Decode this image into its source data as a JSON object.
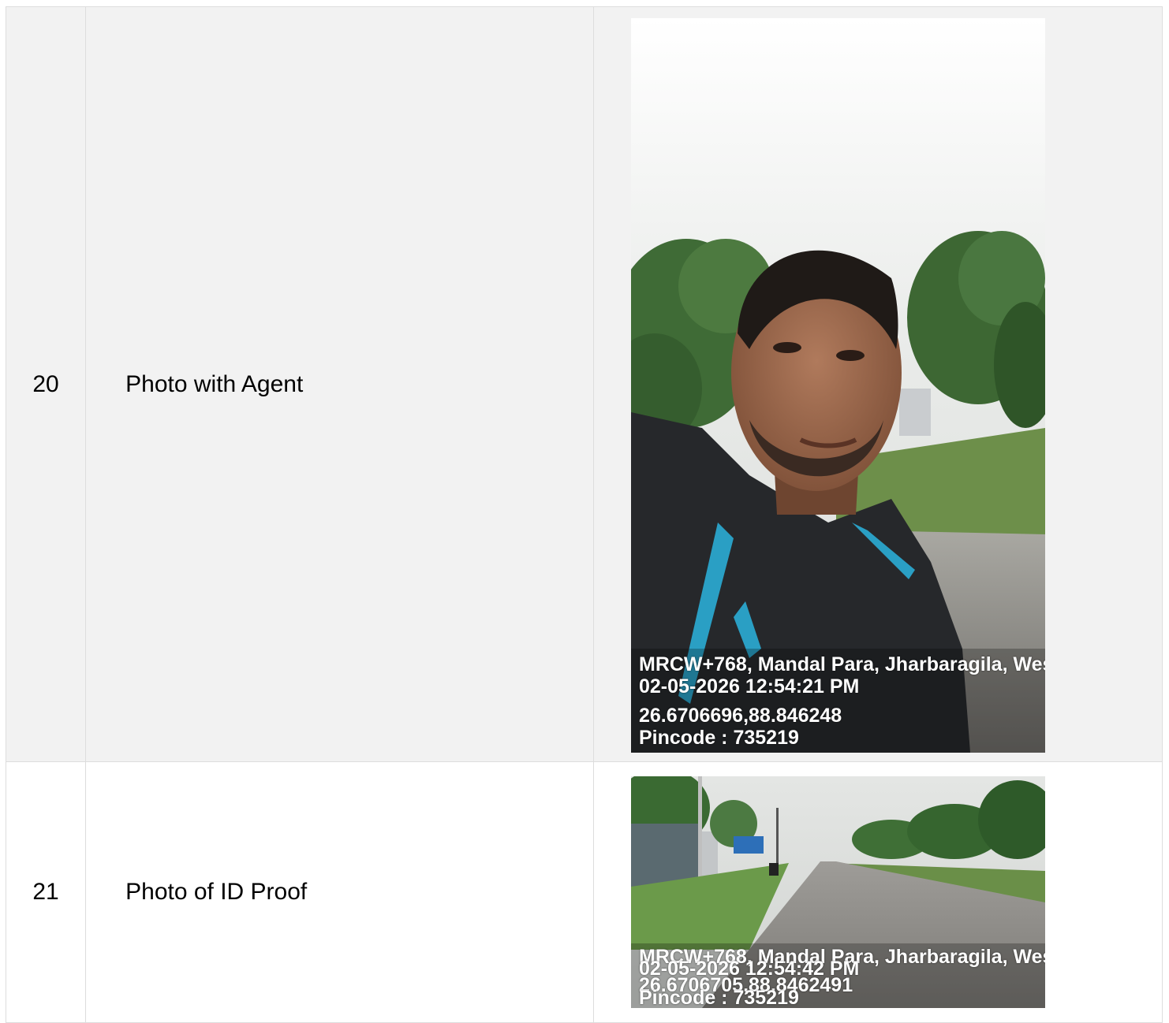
{
  "rows": [
    {
      "number": "20",
      "label": "Photo with Agent",
      "stamp": {
        "address": "MRCW+768, Mandal Para, Jharbaragila, Wes",
        "datetime": "02-05-2026 12:54:21 PM",
        "coords": "26.6706696,88.846248",
        "pincode": "Pincode : 735219"
      }
    },
    {
      "number": "21",
      "label": "Photo of ID Proof",
      "stamp": {
        "address": "MRCW+768, Mandal Para, Jharbaragila, Wes",
        "datetime": "02-05-2026 12:54:42 PM",
        "coords": "26.6706705,88.8462491",
        "pincode": "Pincode : 735219"
      }
    }
  ]
}
